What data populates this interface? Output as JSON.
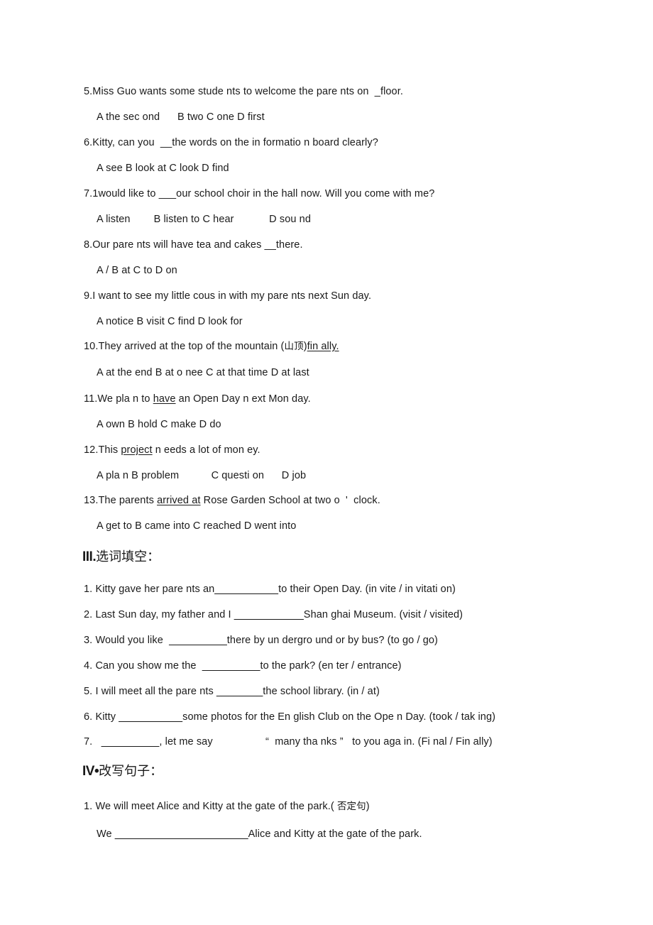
{
  "document": {
    "type": "english-worksheet-scan",
    "background": "#ffffff",
    "text_color": "#1a1a1a"
  },
  "multiple_choice": {
    "items": [
      {
        "number": "5.",
        "question": "Miss Guo wants some stude nts to welcome the pare nts on  _floor.",
        "options": "A the sec ond      B two C one D first"
      },
      {
        "number": "6.",
        "question": "Kitty, can you  __the words on the in formatio n board clearly?",
        "options": "A see B look at C look D find"
      },
      {
        "number": "7.1",
        "question": "would like to ___our school choir in the hall now. Will you come with me?",
        "options": "A listen        B listen to C hear            D sou nd"
      },
      {
        "number": "8.",
        "question": "Our pare nts will have tea and cakes __there.",
        "options": "A / B at C to D on"
      },
      {
        "number": "9.",
        "question": "I want to see my little cous in with my pare nts next Sun day.",
        "options": "A notice B visit C find D look for"
      },
      {
        "number": "10.",
        "question_pre": "They arrived at the top of the mountain (",
        "question_cn": "山顶",
        "question_mid": ")",
        "question_underlined": "fin ally.",
        "options": "A at the end B at o nee C at that time D at last"
      },
      {
        "number": "11.",
        "question_pre": "We pla n to ",
        "question_underlined": "have",
        "question_post": " an Open Day n ext Mon day.",
        "options": "A own B hold C make D do"
      },
      {
        "number": "12.",
        "question_pre": "This ",
        "question_underlined": "project",
        "question_post": " n eeds a lot of mon ey.",
        "options": "A pla n B problem           C questi on      D job"
      },
      {
        "number": "13.",
        "question_pre": "The parents ",
        "question_underlined": "arrived at",
        "question_post": " Rose Garden School at two o  '  clock.",
        "options": "A get to B came into C reached D went into"
      }
    ]
  },
  "section_three": {
    "numeral": "III.",
    "title_cn": "选词填空：",
    "items": [
      {
        "number": "1.",
        "pre": "Kitty gave her pare nts an",
        "blank": "___________",
        "post": "to their Open Day. (in vite / in vitati on)"
      },
      {
        "number": "2.",
        "pre": "Last Sun day, my father and I ",
        "blank": "____________",
        "post": "Shan ghai Museum. (visit / visited)"
      },
      {
        "number": "3.",
        "pre": "Would you like  ",
        "blank": "__________",
        "post": "there by un dergro und or by bus? (to go / go)"
      },
      {
        "number": "4.",
        "pre": "Can you show me the  ",
        "blank": "__________",
        "post": "to the park? (en ter / entrance)"
      },
      {
        "number": "5.",
        "pre": "I will meet all the pare nts ",
        "blank": "________",
        "post": "the school library. (in / at)"
      },
      {
        "number": "6.",
        "pre": "Kitty ",
        "blank": "___________",
        "post": "some photos for the En glish Club on the Ope n Day. (took / tak ing)"
      },
      {
        "number": "7.",
        "pre": "  ",
        "blank": "__________",
        "post": ", let me say                  “  many tha nks ”   to you aga in. (Fi nal / Fin ally)"
      }
    ]
  },
  "section_four": {
    "numeral": "IV•",
    "title_cn": "改写句子：",
    "items": [
      {
        "number": "1.",
        "question_pre": "We will meet Alice and Kitty at the gate of the park.( ",
        "question_cn": "否定句",
        "question_post": ")",
        "answer_pre": "We ",
        "answer_blank": "_______________________",
        "answer_post": "Alice and Kitty at the gate of the park."
      }
    ]
  }
}
